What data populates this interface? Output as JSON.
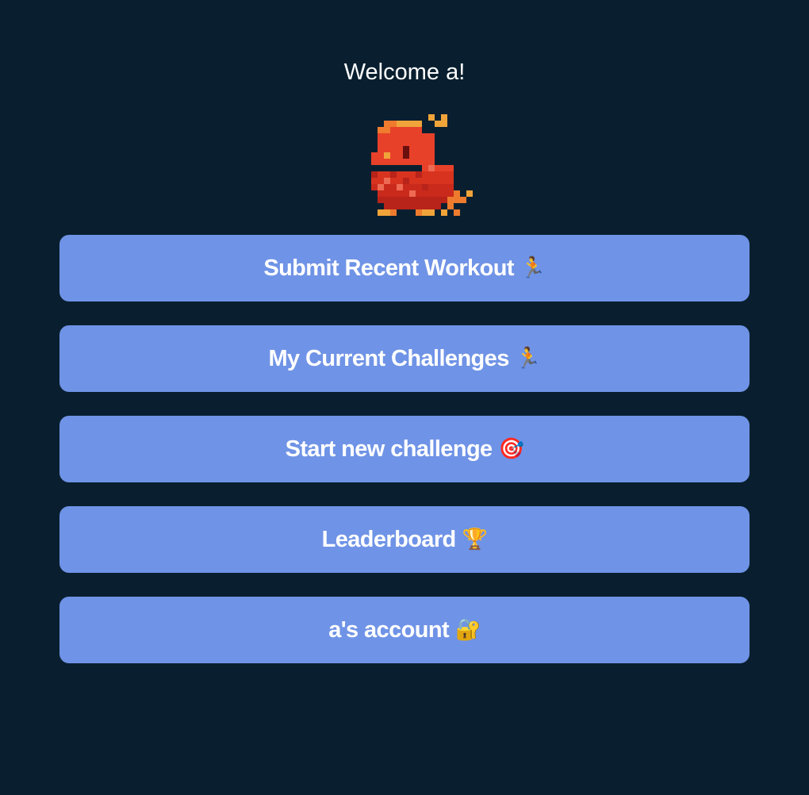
{
  "greeting": "Welcome a!",
  "colors": {
    "background": "#091f2f",
    "button": "#6f93e6",
    "text": "#ffffff"
  },
  "mascot": {
    "icon": "red-pixel-bird-icon"
  },
  "menu": {
    "items": [
      {
        "label": "Submit Recent Workout",
        "emoji": "🏃",
        "icon": "running-person-icon"
      },
      {
        "label": "My Current Challenges",
        "emoji": "🏃",
        "icon": "running-person-icon"
      },
      {
        "label": "Start new challenge",
        "emoji": "🎯",
        "icon": "dart-target-icon"
      },
      {
        "label": "Leaderboard",
        "emoji": "🏆",
        "icon": "trophy-icon"
      },
      {
        "label": "a's account",
        "emoji": "🔐",
        "icon": "lock-key-icon"
      }
    ]
  }
}
